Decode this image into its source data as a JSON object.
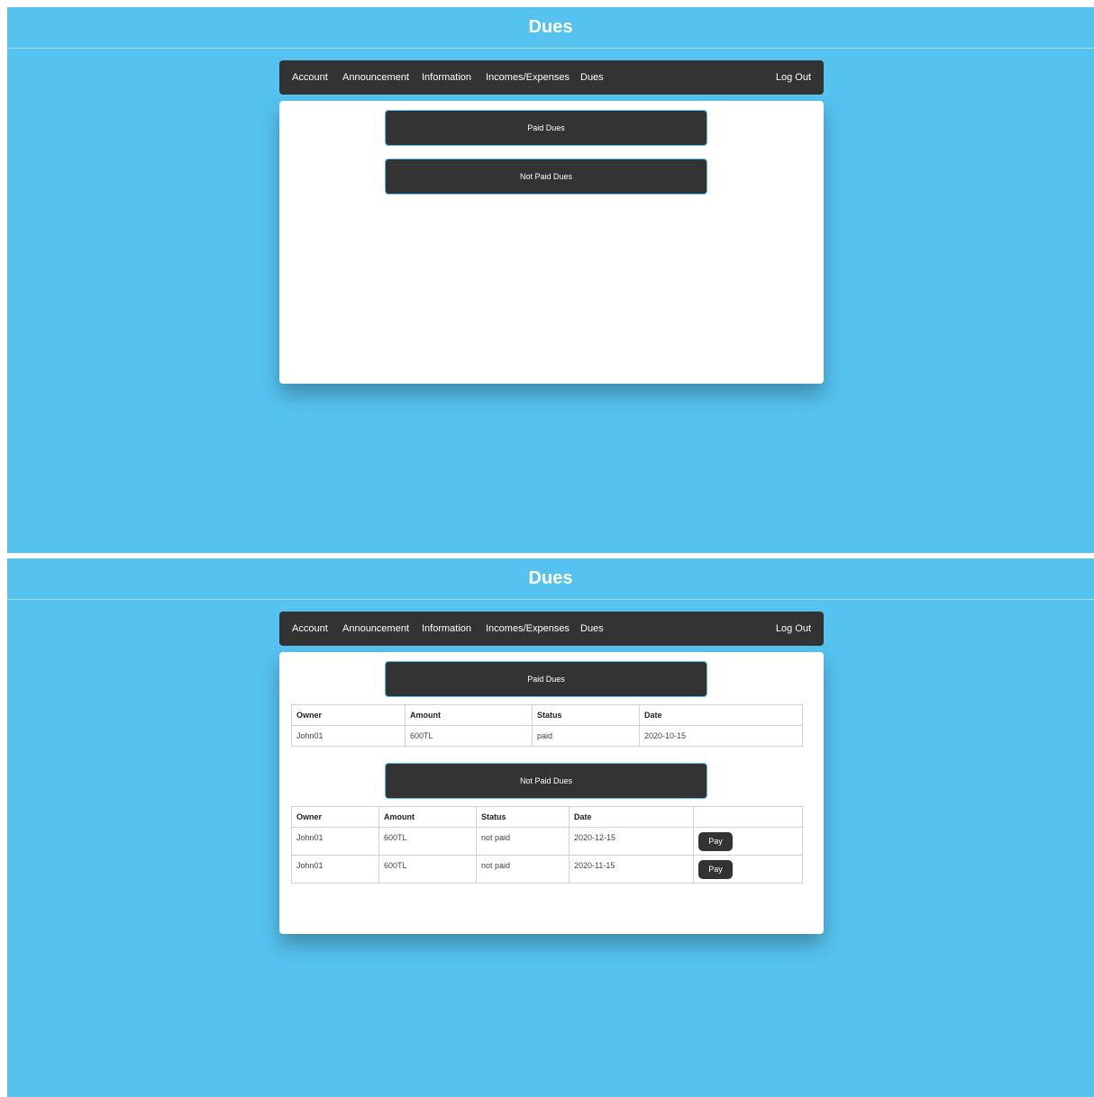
{
  "page_title": "Dues",
  "nav": {
    "items": [
      "Account",
      "Announcement",
      "Information",
      "Incomes/Expenses",
      "Dues"
    ],
    "logout": "Log Out"
  },
  "sections": {
    "paid_label": "Paid Dues",
    "not_paid_label": "Not Paid Dues"
  },
  "paid_table": {
    "headers": [
      "Owner",
      "Amount",
      "Status",
      "Date"
    ],
    "rows": [
      [
        "John01",
        "600TL",
        "paid",
        "2020-10-15"
      ]
    ]
  },
  "not_paid_table": {
    "headers": [
      "Owner",
      "Amount",
      "Status",
      "Date",
      ""
    ],
    "rows": [
      [
        "John01",
        "600TL",
        "not paid",
        "2020-12-15"
      ],
      [
        "John01",
        "600TL",
        "not paid",
        "2020-11-15"
      ]
    ],
    "action_label": "Pay"
  },
  "colors": {
    "background": "#56c2ef",
    "navbar": "#333333",
    "card": "#ffffff"
  }
}
